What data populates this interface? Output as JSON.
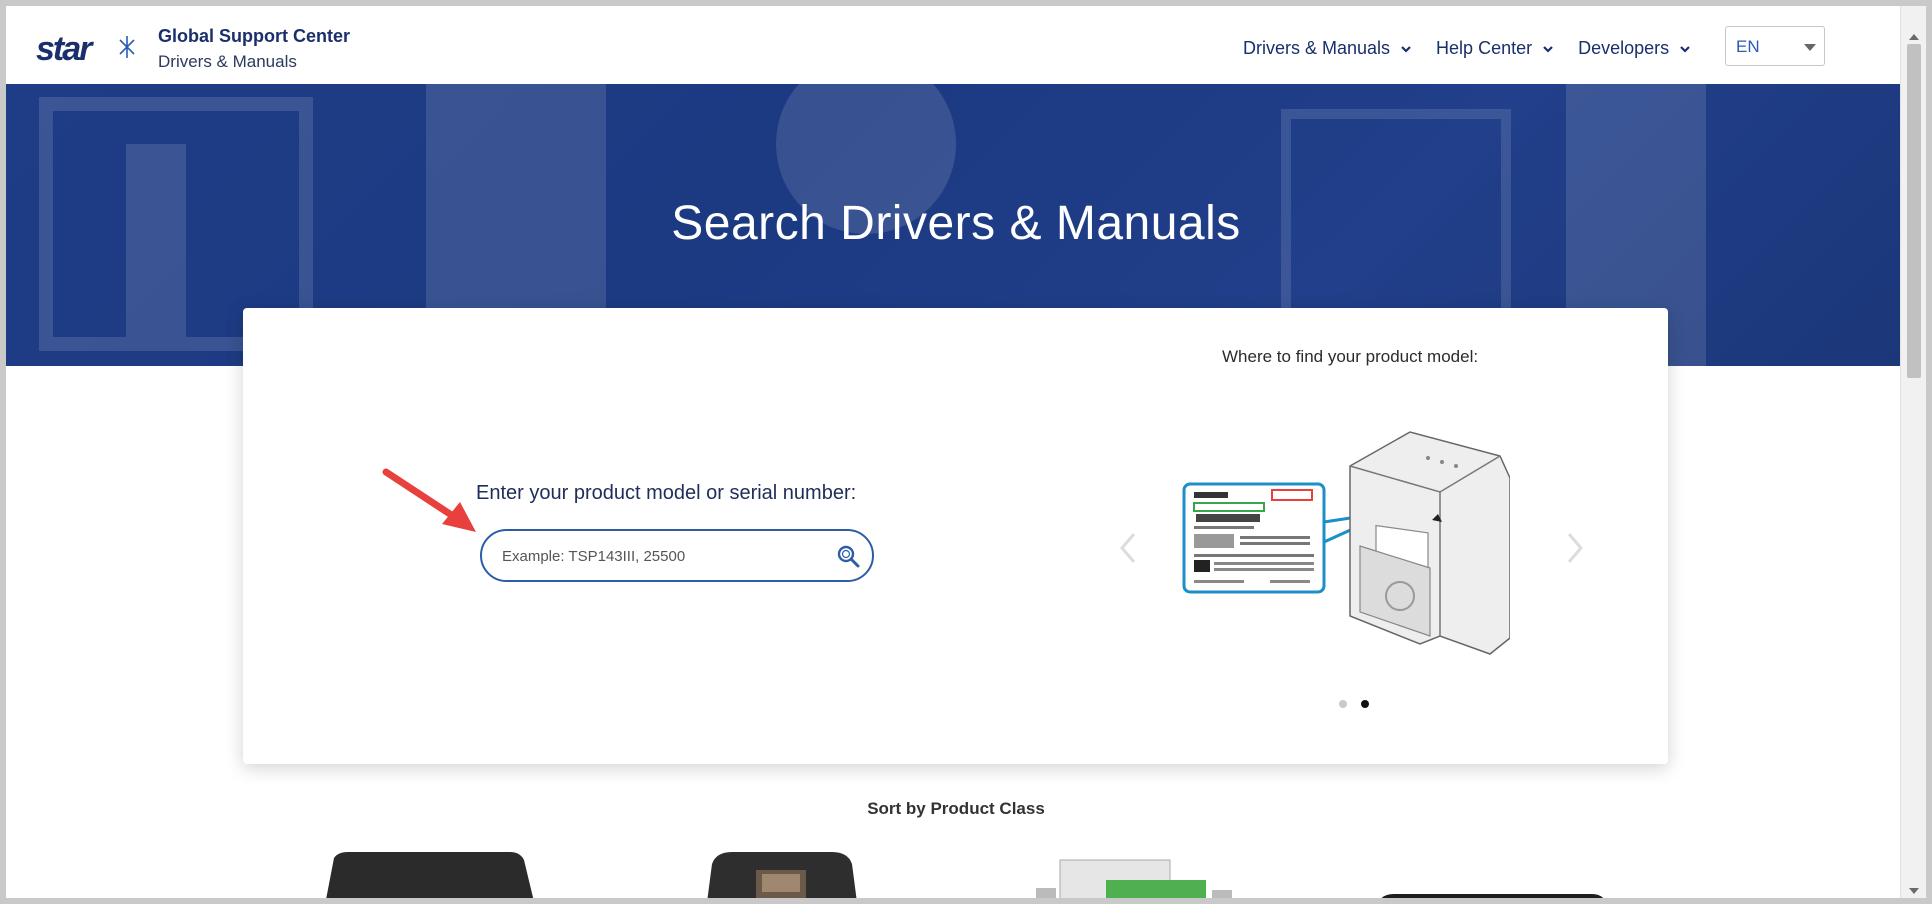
{
  "header": {
    "brand_title": "Global Support Center",
    "brand_subtitle": "Drivers & Manuals",
    "logo_icon": "star-logo-icon",
    "nav": [
      {
        "label": "Drivers & Manuals",
        "icon": "chevron-down-icon"
      },
      {
        "label": "Help Center",
        "icon": "chevron-down-icon"
      },
      {
        "label": "Developers",
        "icon": "chevron-down-icon"
      }
    ],
    "language": {
      "selected": "EN"
    }
  },
  "hero": {
    "title": "Search Drivers & Manuals"
  },
  "search": {
    "label": "Enter your product model or serial number:",
    "placeholder": "Example: TSP143III, 25500",
    "value": "",
    "button_icon": "search-icon"
  },
  "product_help": {
    "label": "Where to find your product model:",
    "prev_icon": "chevron-left-icon",
    "next_icon": "chevron-right-icon",
    "active_slide": 2,
    "slide_count": 2
  },
  "sort": {
    "title": "Sort by Product Class"
  },
  "colors": {
    "brand_navy": "#1a2f6b",
    "hero_blue": "#1f3d86",
    "link_blue": "#2a5bb5",
    "search_border": "#2b5ea7",
    "annotation_red": "#e8403c",
    "label_highlight": "#1c8fc9"
  }
}
